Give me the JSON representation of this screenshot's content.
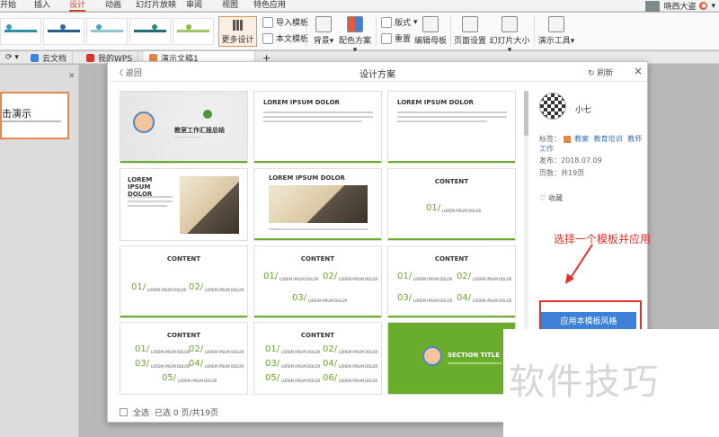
{
  "menubar": {
    "tabs": [
      "开始",
      "插入",
      "设计",
      "动画",
      "幻灯片放映",
      "审阅",
      "视图",
      "特色应用"
    ],
    "active": "设计",
    "user_name": "晓西大盗"
  },
  "ribbon": {
    "more_design": "更多设计",
    "import_template": "导入模板",
    "doc_template": "本文模板",
    "background": "背景",
    "color_scheme": "配色方案",
    "layout": "版式",
    "reset": "重置",
    "edit_master": "编辑母板",
    "page_setup": "页面设置",
    "slide_size": "幻灯片大小",
    "presenter_tools": "演示工具"
  },
  "doc_tabs": [
    {
      "label": "云文档",
      "color": "#3d82d8"
    },
    {
      "label": "我的WPS",
      "color": "#d6352d"
    },
    {
      "label": "演示文稿1",
      "color": "#e5874a"
    }
  ],
  "slide_panel": {
    "thumb_title": "击演示"
  },
  "dialog": {
    "back": "返回",
    "title": "设计方案",
    "refresh": "刷新",
    "close": "×",
    "select_all": "全选",
    "selected_status": "已选 0 页/共19页"
  },
  "templates": {
    "t1_title": "教室工作汇报总结",
    "lorem": "LOREM IPSUM DOLOR",
    "content": "CONTENT",
    "section_title": "SECTION TITLE",
    "item_label": "LOREM IPSUM DOLOR",
    "nums": [
      "01/",
      "02/",
      "03/",
      "04/",
      "05/",
      "06/"
    ]
  },
  "info": {
    "author": "小七",
    "tags_label": "标签：",
    "tags": [
      "教案",
      "教育培训",
      "教师工作"
    ],
    "publish_label": "发布：",
    "publish_date": "2018.07.09",
    "pages_label": "页数：",
    "pages": "共19页",
    "favorite": "收藏",
    "apply_button": "应用本模板风格"
  },
  "annotation": "选择一个模板并应用",
  "watermark": "软件技巧",
  "colors": {
    "accent_green": "#6aad2d",
    "apply_blue": "#3d82d8",
    "annotation_red": "#e0312a",
    "active_tab": "#c8492c"
  }
}
